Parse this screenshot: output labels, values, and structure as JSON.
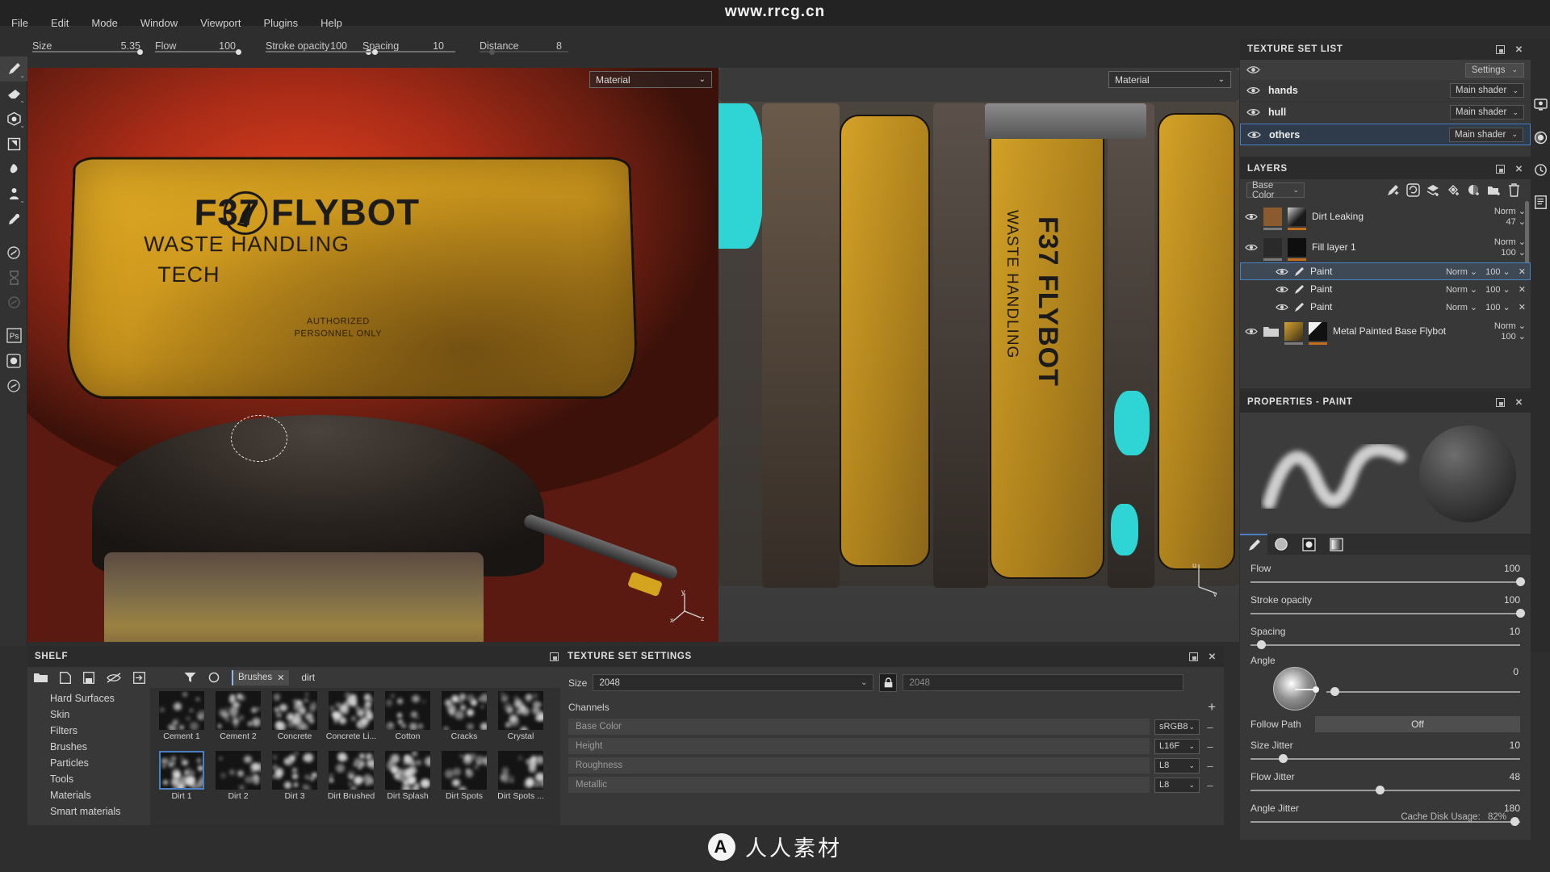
{
  "watermarks": {
    "top": "www.rrcg.cn",
    "bottom": "人人素材",
    "logo": "A"
  },
  "menubar": {
    "items": [
      "File",
      "Edit",
      "Mode",
      "Window",
      "Viewport",
      "Plugins",
      "Help"
    ]
  },
  "toolbar": {
    "params": [
      {
        "label": "Size",
        "value": "5.35"
      },
      {
        "label": "Flow",
        "value": "100"
      },
      {
        "label": "Stroke opacity",
        "value": "100"
      },
      {
        "label": "Spacing",
        "value": "10"
      },
      {
        "label": "Distance",
        "value": "8"
      }
    ],
    "icons": [
      "mirror-icon",
      "symmetry-icon",
      "display-mode-icon",
      "shading-icon",
      "camera-icon"
    ]
  },
  "viewport_left": {
    "dropdown": "Material",
    "axis": "x y z"
  },
  "viewport_right": {
    "dropdown": "Material"
  },
  "model_text": {
    "title": "F37 FLYBOT",
    "line1": "WASTE HANDLING",
    "line2": "TECH",
    "note1": "AUTHORIZED",
    "note2": "PERSONNEL ONLY"
  },
  "texture_set_list": {
    "title": "TEXTURE SET LIST",
    "settings_label": "Settings",
    "sets": [
      {
        "name": "hands",
        "shader": "Main shader",
        "selected": false
      },
      {
        "name": "hull",
        "shader": "Main shader",
        "selected": false
      },
      {
        "name": "others",
        "shader": "Main shader",
        "selected": true
      }
    ]
  },
  "layers": {
    "title": "LAYERS",
    "channel": "Base Color",
    "tool_icons": [
      "smart-mask-icon",
      "add-effect-icon",
      "add-layer-icon",
      "add-fill-layer-icon",
      "add-mask-icon",
      "add-folder-icon",
      "delete-icon"
    ],
    "items": [
      {
        "name": "Dirt Leaking",
        "blend": "Norm",
        "opacity": "47",
        "type": "fill",
        "indent": 0,
        "selected": false
      },
      {
        "name": "Fill layer 1",
        "blend": "Norm",
        "opacity": "100",
        "type": "fill",
        "indent": 0,
        "selected": false
      },
      {
        "name": "Paint",
        "blend": "Norm",
        "opacity": "100",
        "type": "paint",
        "indent": 1,
        "selected": true
      },
      {
        "name": "Paint",
        "blend": "Norm",
        "opacity": "100",
        "type": "paint",
        "indent": 1,
        "selected": false
      },
      {
        "name": "Paint",
        "blend": "Norm",
        "opacity": "100",
        "type": "paint",
        "indent": 1,
        "selected": false
      },
      {
        "name": "Metal Painted Base Flybot",
        "blend": "Norm",
        "opacity": "100",
        "type": "folder",
        "indent": 0,
        "selected": false
      }
    ]
  },
  "properties": {
    "title": "PROPERTIES - PAINT",
    "tabs": [
      "brush-icon",
      "grid-icon",
      "alpha-icon",
      "gradient-icon"
    ],
    "active_tab": 0,
    "sliders": [
      {
        "label": "Flow",
        "value": "100",
        "pct": 100
      },
      {
        "label": "Stroke opacity",
        "value": "100",
        "pct": 100
      },
      {
        "label": "Spacing",
        "value": "10",
        "pct": 4
      }
    ],
    "angle": {
      "label": "Angle",
      "value": "0",
      "pct": 4
    },
    "follow_path": {
      "label": "Follow Path",
      "value": "Off"
    },
    "jitters": [
      {
        "label": "Size Jitter",
        "value": "10",
        "pct": 12
      },
      {
        "label": "Flow Jitter",
        "value": "48",
        "pct": 48
      },
      {
        "label": "Angle Jitter",
        "value": "180",
        "pct": 98
      }
    ]
  },
  "shelf": {
    "title": "SHELF",
    "tool_icons": [
      "folder-icon",
      "new-icon",
      "save-icon",
      "hide-icon",
      "import-icon"
    ],
    "filter_icon": "filter-icon",
    "refresh_icon": "refresh-icon",
    "tag": "Brushes",
    "search_value": "dirt",
    "categories": [
      "Hard Surfaces",
      "Skin",
      "Filters",
      "Brushes",
      "Particles",
      "Tools",
      "Materials",
      "Smart materials"
    ],
    "brushes": [
      {
        "name": "Cement 1",
        "selected": false
      },
      {
        "name": "Cement 2",
        "selected": false
      },
      {
        "name": "Concrete",
        "selected": false
      },
      {
        "name": "Concrete Li...",
        "selected": false
      },
      {
        "name": "Cotton",
        "selected": false
      },
      {
        "name": "Cracks",
        "selected": false
      },
      {
        "name": "Crystal",
        "selected": false
      },
      {
        "name": "Dirt 1",
        "selected": true
      },
      {
        "name": "Dirt 2",
        "selected": false
      },
      {
        "name": "Dirt 3",
        "selected": false
      },
      {
        "name": "Dirt Brushed",
        "selected": false
      },
      {
        "name": "Dirt Splash",
        "selected": false
      },
      {
        "name": "Dirt Spots",
        "selected": false
      },
      {
        "name": "Dirt Spots ...",
        "selected": false
      }
    ]
  },
  "texture_set_settings": {
    "title": "TEXTURE SET SETTINGS",
    "size_label": "Size",
    "size_width": "2048",
    "size_height": "2048",
    "channels_label": "Channels",
    "channels": [
      {
        "name": "Base Color",
        "format": "sRGB8"
      },
      {
        "name": "Height",
        "format": "L16F"
      },
      {
        "name": "Roughness",
        "format": "L8"
      },
      {
        "name": "Metallic",
        "format": "L8"
      }
    ]
  },
  "status": {
    "cache": "Cache Disk Usage:",
    "cache_value": "82%"
  },
  "right_rail": [
    "display-settings-icon",
    "shader-settings-icon",
    "history-icon",
    "log-icon"
  ],
  "left_rail": [
    "paint-icon",
    "eraser-icon",
    "projection-icon",
    "polygon-fill-icon",
    "smudge-icon",
    "clone-icon",
    "eyedropper-icon",
    "material-icon",
    "bake-icon",
    "geometry-icon",
    "photoshop-icon",
    "render-icon",
    "substance-icon"
  ]
}
